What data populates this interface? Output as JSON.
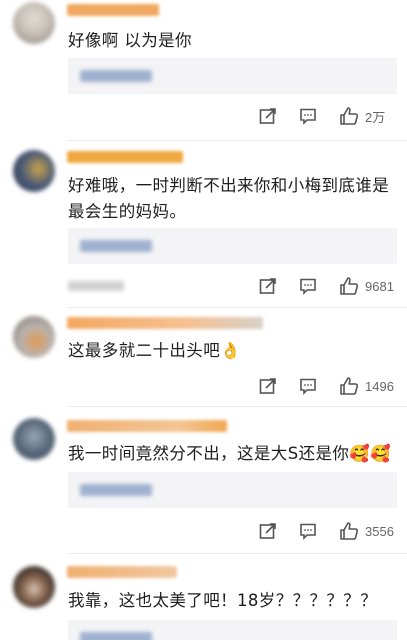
{
  "comments": [
    {
      "text": "好像啊 以为是你",
      "like_count": "2万",
      "avatar_colors": [
        "#c8c0b8",
        "#8a8580",
        "#e0dcd6"
      ],
      "name_color": "#f0a860",
      "icons": [
        "share-icon",
        "comment-icon",
        "like-icon"
      ]
    },
    {
      "text": "好难哦，一时判断不出来你和小梅到底谁是最会生的妈妈。",
      "like_count": "9681",
      "avatar_colors": [
        "#4b5a78",
        "#c9a24a",
        "#2b3346"
      ],
      "name_color": "#f0a840",
      "icons": [
        "share-icon",
        "comment-icon",
        "like-icon"
      ]
    },
    {
      "text": "这最多就二十出头吧👌",
      "like_count": "1496",
      "avatar_colors": [
        "#b9b2ae",
        "#e09a55",
        "#7a6f6a"
      ],
      "name_color": "#f4a860",
      "icons": [
        "share-icon",
        "comment-icon",
        "like-icon"
      ]
    },
    {
      "text": "我一时间竟然分不出，这是大S还是你🥰🥰",
      "like_count": "3556",
      "avatar_colors": [
        "#5a6a7c",
        "#98a6b6",
        "#3d4a58"
      ],
      "name_color": "#f0b070",
      "icons": [
        "share-icon",
        "comment-icon",
        "like-icon"
      ]
    },
    {
      "text": "我靠，这也太美了吧！18岁？？？？？？",
      "like_count": "",
      "avatar_colors": [
        "#2a2420",
        "#8b6a55",
        "#d9c5b5"
      ],
      "name_color": "#f0b070",
      "icons": []
    }
  ],
  "colors": {
    "reply_box_bg": "#f4f4f6",
    "reply_blur": "#9eb0cf",
    "icon_stroke": "#555555",
    "count_text": "#666666"
  }
}
